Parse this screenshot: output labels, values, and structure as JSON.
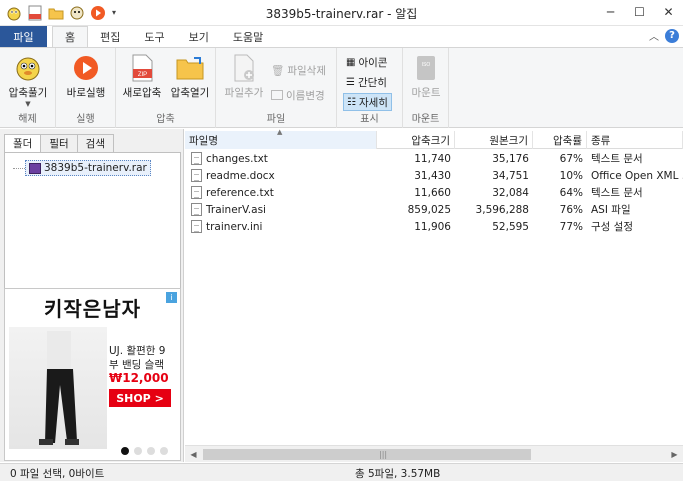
{
  "window": {
    "title": "3839b5-trainerv.rar - 알집",
    "controls": [
      "minimize",
      "maximize",
      "close"
    ]
  },
  "menu": {
    "file_label": "파일",
    "tabs": [
      "홈",
      "편집",
      "도구",
      "보기",
      "도움말"
    ],
    "active_tab": "홈"
  },
  "ribbon": {
    "groups": [
      {
        "label": "해제",
        "buttons": [
          {
            "label": "압축풀기",
            "icon": "unzip-mascot-icon"
          }
        ]
      },
      {
        "label": "실행",
        "buttons": [
          {
            "label": "바로실행",
            "icon": "play-icon"
          }
        ]
      },
      {
        "label": "압축",
        "buttons": [
          {
            "label": "새로압축",
            "icon": "zip-file-icon"
          },
          {
            "label": "압축열기",
            "icon": "folder-open-icon"
          }
        ]
      },
      {
        "label": "파일",
        "buttons": [
          {
            "label": "파일추가",
            "icon": "add-file-icon",
            "disabled": true
          },
          {
            "label": "파일삭제",
            "icon": "trash-icon",
            "disabled": true
          },
          {
            "label": "이름변경",
            "icon": "rename-icon",
            "disabled": true
          }
        ]
      },
      {
        "label": "표시",
        "buttons": [
          {
            "label": "아이콘",
            "icon": "grid-view-icon"
          },
          {
            "label": "간단히",
            "icon": "list-view-icon"
          },
          {
            "label": "자세히",
            "icon": "details-view-icon",
            "selected": true
          }
        ]
      },
      {
        "label": "마운트",
        "buttons": [
          {
            "label": "마운트",
            "icon": "iso-icon",
            "disabled": true
          }
        ]
      }
    ]
  },
  "left_pane": {
    "tabs": [
      "폴더",
      "필터",
      "검색"
    ],
    "active_tab": "폴더",
    "tree_root": "3839b5-trainerv.rar"
  },
  "ad": {
    "title": "키작은남자",
    "desc_line1": "UJ. 활편한 9",
    "desc_line2": "부 밴딩 슬랙",
    "price": "₩12,000",
    "cta": "SHOP >"
  },
  "file_list": {
    "columns": [
      "파일명",
      "압축크기",
      "원본크기",
      "압축률",
      "종류"
    ],
    "rows": [
      {
        "name": "changes.txt",
        "packed": "11,740",
        "original": "35,176",
        "ratio": "67%",
        "type": "텍스트 문서"
      },
      {
        "name": "readme.docx",
        "packed": "31,430",
        "original": "34,751",
        "ratio": "10%",
        "type": "Office Open XML ..."
      },
      {
        "name": "reference.txt",
        "packed": "11,660",
        "original": "32,084",
        "ratio": "64%",
        "type": "텍스트 문서"
      },
      {
        "name": "TrainerV.asi",
        "packed": "859,025",
        "original": "3,596,288",
        "ratio": "76%",
        "type": "ASI 파일"
      },
      {
        "name": "trainerv.ini",
        "packed": "11,906",
        "original": "52,595",
        "ratio": "77%",
        "type": "구성 설정"
      }
    ]
  },
  "status": {
    "selection": "0 파일 선택,  0바이트",
    "total": "총 5파일,  3.57MB"
  }
}
